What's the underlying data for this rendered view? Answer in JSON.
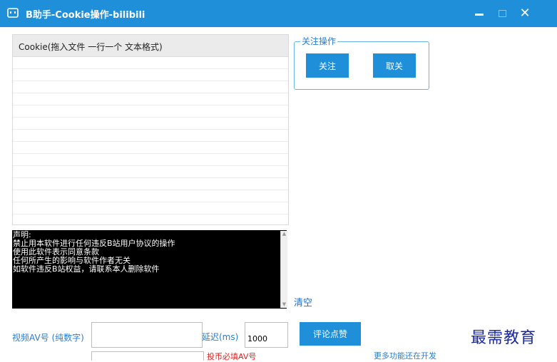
{
  "window": {
    "title": "B助手-Cookie操作-bilibili",
    "accent_color": "#1e8fd8",
    "controls": {
      "minimize_icon": "minimize-icon",
      "maximize_icon": "maximize-icon",
      "close_icon": "close-icon",
      "close_glyph": "✕"
    }
  },
  "cookie_list": {
    "header": "Cookie(拖入文件 一行一个 文本格式)",
    "items": []
  },
  "follow_group": {
    "legend": "关注操作",
    "follow_label": "关注",
    "unfollow_label": "取关"
  },
  "notice": {
    "lines": [
      "声明:",
      "禁止用本软件进行任何违反B站用户协议的操作",
      "使用此软件表示同意条款",
      "任何所产生的影响与软件作者无关",
      "如软件违反B站权益，请联系本人删除软件"
    ]
  },
  "clear_label": "清空",
  "form": {
    "av_label": "视频AV号 (纯数字)",
    "av_value": "",
    "delay_label": "延迟(ms)",
    "delay_value": "1000",
    "comment_like_label": "评论点赞",
    "required_note": "投币必填AV号",
    "more_note": "更多功能还在开发"
  },
  "watermark": "最需教育"
}
